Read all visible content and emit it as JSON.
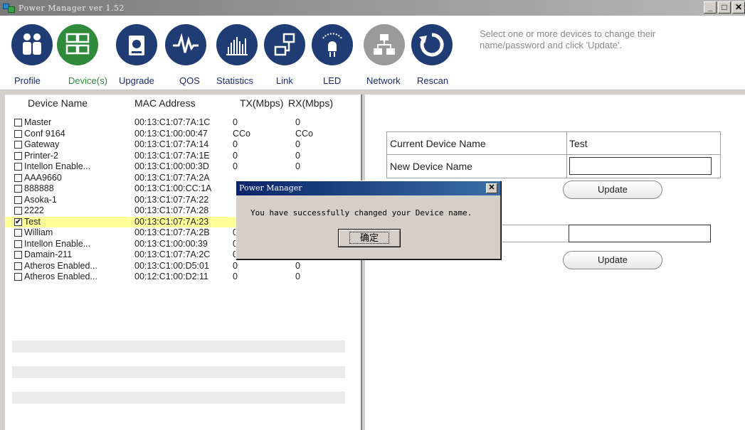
{
  "window": {
    "title": "Power Manager ver 1.52"
  },
  "toolbar": {
    "buttons": [
      {
        "label": "Profile",
        "icon": "people-icon",
        "color": "#1f3c74"
      },
      {
        "label": "Device(s)",
        "icon": "devices-icon",
        "color": "#2f8a3c"
      },
      {
        "label": "Upgrade",
        "icon": "upgrade-icon",
        "color": "#1f3c74"
      },
      {
        "label": "QOS",
        "icon": "waveform-icon",
        "color": "#1f3c74"
      },
      {
        "label": "Statistics",
        "icon": "bar-chart-icon",
        "color": "#1f3c74"
      },
      {
        "label": "Link",
        "icon": "network-link-icon",
        "color": "#1f3c74"
      },
      {
        "label": "LED",
        "icon": "led-icon",
        "color": "#1f3c74"
      },
      {
        "label": "Network",
        "icon": "network-icon",
        "color": "#9a9a9a"
      },
      {
        "label": "Rescan",
        "icon": "refresh-icon",
        "color": "#1f3c74"
      }
    ],
    "hint": "Select one or more devices to change their name/password and click 'Update'."
  },
  "device_list": {
    "headers": [
      "Device Name",
      "MAC Address",
      "TX(Mbps)",
      "RX(Mbps)"
    ],
    "rows": [
      {
        "checked": false,
        "name": "Master",
        "mac": "00:13:C1:07:7A:1C",
        "tx": "0",
        "rx": "0"
      },
      {
        "checked": false,
        "name": "Conf 9164",
        "mac": "00:13:C1:00:00:47",
        "tx": "CCo",
        "rx": "CCo"
      },
      {
        "checked": false,
        "name": "Gateway",
        "mac": "00:13:C1:07:7A:14",
        "tx": "0",
        "rx": "0"
      },
      {
        "checked": false,
        "name": "Printer-2",
        "mac": "00:13:C1:07:7A:1E",
        "tx": "0",
        "rx": "0"
      },
      {
        "checked": false,
        "name": "Intellon Enable...",
        "mac": "00:13:C1:00:00:3D",
        "tx": "0",
        "rx": "0"
      },
      {
        "checked": false,
        "name": "AAA9660",
        "mac": "00:13:C1:07:7A:2A",
        "tx": "",
        "rx": ""
      },
      {
        "checked": false,
        "name": "888888",
        "mac": "00:13:C1:00:CC:1A",
        "tx": "",
        "rx": ""
      },
      {
        "checked": false,
        "name": "Asoka-1",
        "mac": "00:13:C1:07:7A:22",
        "tx": "",
        "rx": ""
      },
      {
        "checked": false,
        "name": "2222",
        "mac": "00:13:C1:07:7A:28",
        "tx": "",
        "rx": ""
      },
      {
        "checked": true,
        "name": "Test",
        "mac": "00:13:C1:07:7A:23",
        "tx": "",
        "rx": ""
      },
      {
        "checked": false,
        "name": "William",
        "mac": "00:13:C1:07:7A:2B",
        "tx": "0",
        "rx": "0"
      },
      {
        "checked": false,
        "name": "Intellon Enable...",
        "mac": "00:13:C1:00:00:39",
        "tx": "0",
        "rx": "0"
      },
      {
        "checked": false,
        "name": "Damain-211",
        "mac": "00:13:C1:07:7A:2C",
        "tx": "0",
        "rx": "0"
      },
      {
        "checked": false,
        "name": "Atheros Enabled...",
        "mac": "00:13:C1:00:D5:01",
        "tx": "0",
        "rx": "0"
      },
      {
        "checked": false,
        "name": "Atheros Enabled...",
        "mac": "00:12:C1:00:D2:11",
        "tx": "0",
        "rx": "0"
      }
    ],
    "check_mark": "✔"
  },
  "properties": {
    "current_name_label": "Current Device Name",
    "current_name_value": "Test",
    "new_name_label": "New Device Name",
    "new_name_value": "",
    "update_label": "Update",
    "password_value": ""
  },
  "dialog": {
    "title": "Power Manager",
    "message": "You have successfully changed your Device name.",
    "ok_label": "确定",
    "close_glyph": "✕"
  },
  "window_controls": {
    "minimize": "_",
    "maximize": "□",
    "close": "✕"
  }
}
